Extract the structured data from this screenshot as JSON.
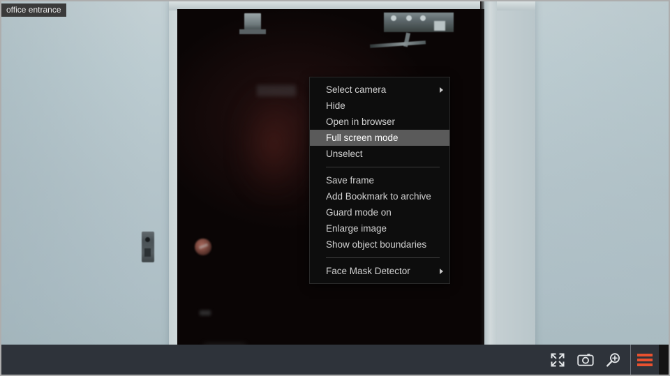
{
  "window": {
    "border_color": "#adadad"
  },
  "video": {
    "camera_label": "office entrance",
    "scene_description": "office entrance",
    "wall_color": "#b4c4ca",
    "door_color": "#0f0808"
  },
  "context_menu": {
    "background_color": "#0d0d0d",
    "highlight_color": "#5a5a5a",
    "text_color": "#d2d2d2",
    "groups": [
      {
        "items": [
          {
            "label": "Select camera",
            "has_submenu": true,
            "selected": false,
            "icon": "chevron-right-icon"
          },
          {
            "label": "Hide",
            "has_submenu": false,
            "selected": false,
            "icon": ""
          },
          {
            "label": "Open in browser",
            "has_submenu": false,
            "selected": false,
            "icon": ""
          },
          {
            "label": "Full screen mode",
            "has_submenu": false,
            "selected": true,
            "icon": ""
          },
          {
            "label": "Unselect",
            "has_submenu": false,
            "selected": false,
            "icon": ""
          }
        ]
      },
      {
        "items": [
          {
            "label": "Save frame",
            "has_submenu": false,
            "selected": false,
            "icon": ""
          },
          {
            "label": "Add Bookmark to archive",
            "has_submenu": false,
            "selected": false,
            "icon": ""
          },
          {
            "label": "Guard mode on",
            "has_submenu": false,
            "selected": false,
            "icon": ""
          },
          {
            "label": "Enlarge image",
            "has_submenu": false,
            "selected": false,
            "icon": ""
          },
          {
            "label": "Show object boundaries",
            "has_submenu": false,
            "selected": false,
            "icon": ""
          }
        ]
      },
      {
        "items": [
          {
            "label": "Face Mask Detector",
            "has_submenu": true,
            "selected": false,
            "icon": "chevron-right-icon"
          }
        ]
      }
    ]
  },
  "toolbar": {
    "background_color": "#2e333a",
    "accent_color": "#e8512f",
    "buttons": [
      {
        "name": "fullscreen-button",
        "icon": "fullscreen-expand-icon",
        "tooltip": "Full screen"
      },
      {
        "name": "snapshot-button",
        "icon": "camera-icon",
        "tooltip": "Save frame"
      },
      {
        "name": "zoom-in-button",
        "icon": "magnifier-plus-icon",
        "tooltip": "Enlarge image"
      },
      {
        "name": "menu-button",
        "icon": "hamburger-menu-icon",
        "tooltip": "Menu"
      }
    ]
  }
}
